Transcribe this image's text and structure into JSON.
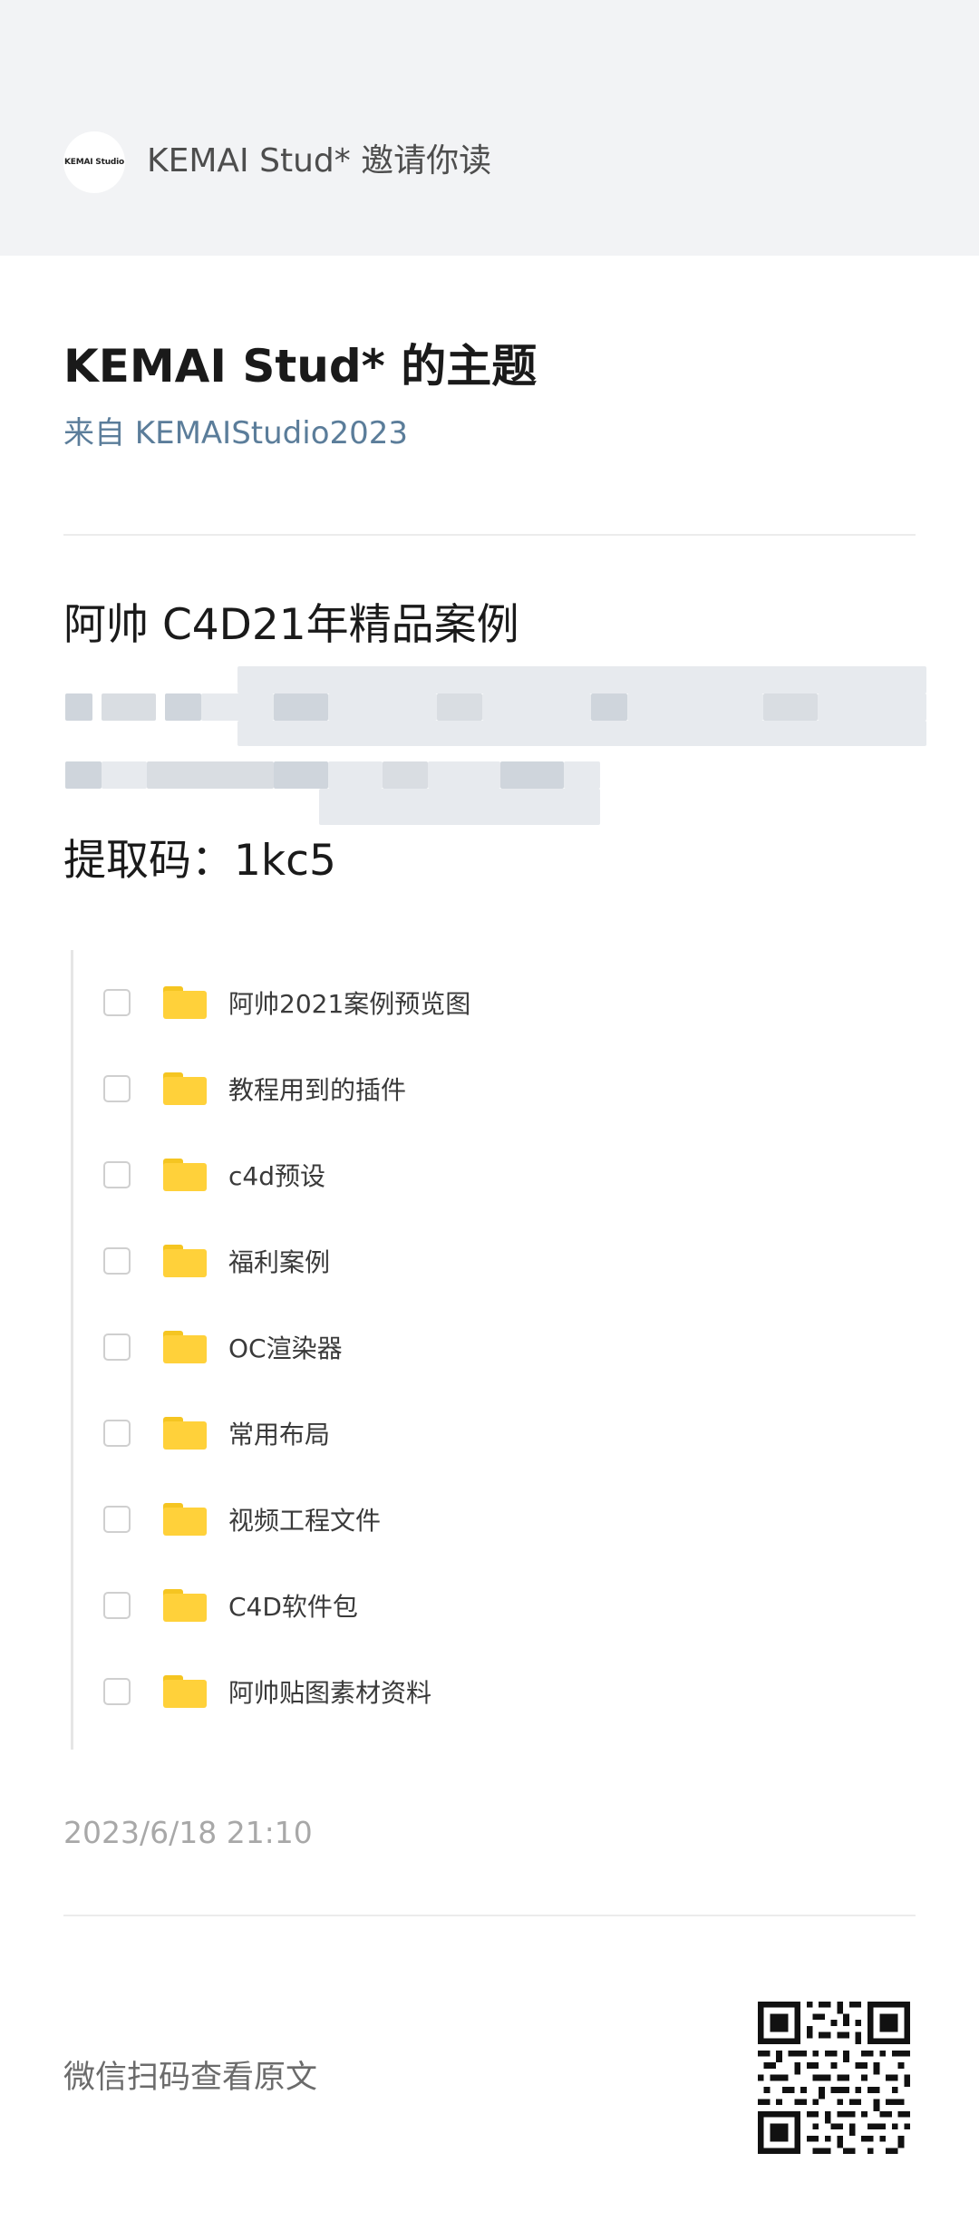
{
  "header": {
    "avatar_text": "KEMAI Studio",
    "invite_text": "KEMAI Stud* 邀请你读"
  },
  "topic": {
    "title": "KEMAI Stud* 的主题",
    "from": "来自 KEMAIStudio2023"
  },
  "post": {
    "title": "阿帅 C4D21年精品案例",
    "code_line": "提取码：1kc5"
  },
  "files": [
    {
      "name": "阿帅2021案例预览图",
      "icon": "folder-icon"
    },
    {
      "name": "教程用到的插件",
      "icon": "folder-icon"
    },
    {
      "name": "c4d预设",
      "icon": "folder-icon"
    },
    {
      "name": "福利案例",
      "icon": "folder-icon"
    },
    {
      "name": "OC渲染器",
      "icon": "folder-icon"
    },
    {
      "name": "常用布局",
      "icon": "folder-icon"
    },
    {
      "name": "视频工程文件",
      "icon": "folder-icon"
    },
    {
      "name": "C4D软件包",
      "icon": "folder-icon"
    },
    {
      "name": "阿帅贴图素材资料",
      "icon": "folder-icon"
    }
  ],
  "footer": {
    "timestamp": "2023/6/18 21:10",
    "scan_hint": "微信扫码查看原文"
  },
  "colors": {
    "header_bg": "#f2f3f5",
    "link_blue": "#5b7d9a",
    "folder_yellow": "#ffd13a"
  }
}
